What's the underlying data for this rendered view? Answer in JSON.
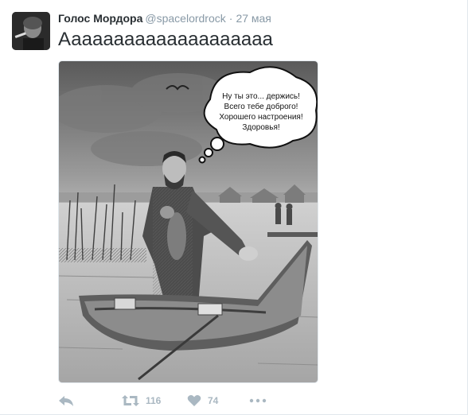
{
  "tweet": {
    "author_name": "Голос Мордора",
    "handle": "@spacelordrock",
    "separator": "·",
    "timestamp": "27 мая",
    "text": "Аааааааааааааааааааа",
    "image": {
      "speech_lines": [
        "Ну ты это... держись!",
        "Всего тебе доброго!",
        "Хорошего настроения!",
        "Здоровья!"
      ]
    },
    "actions": {
      "reply_icon": "reply-icon",
      "retweet_icon": "retweet-icon",
      "retweet_count": "116",
      "like_icon": "heart-icon",
      "like_count": "74",
      "more_icon": "more-icon"
    },
    "colors": {
      "name": "#292f33",
      "meta": "#8899a6",
      "action": "#aab8c2"
    }
  }
}
